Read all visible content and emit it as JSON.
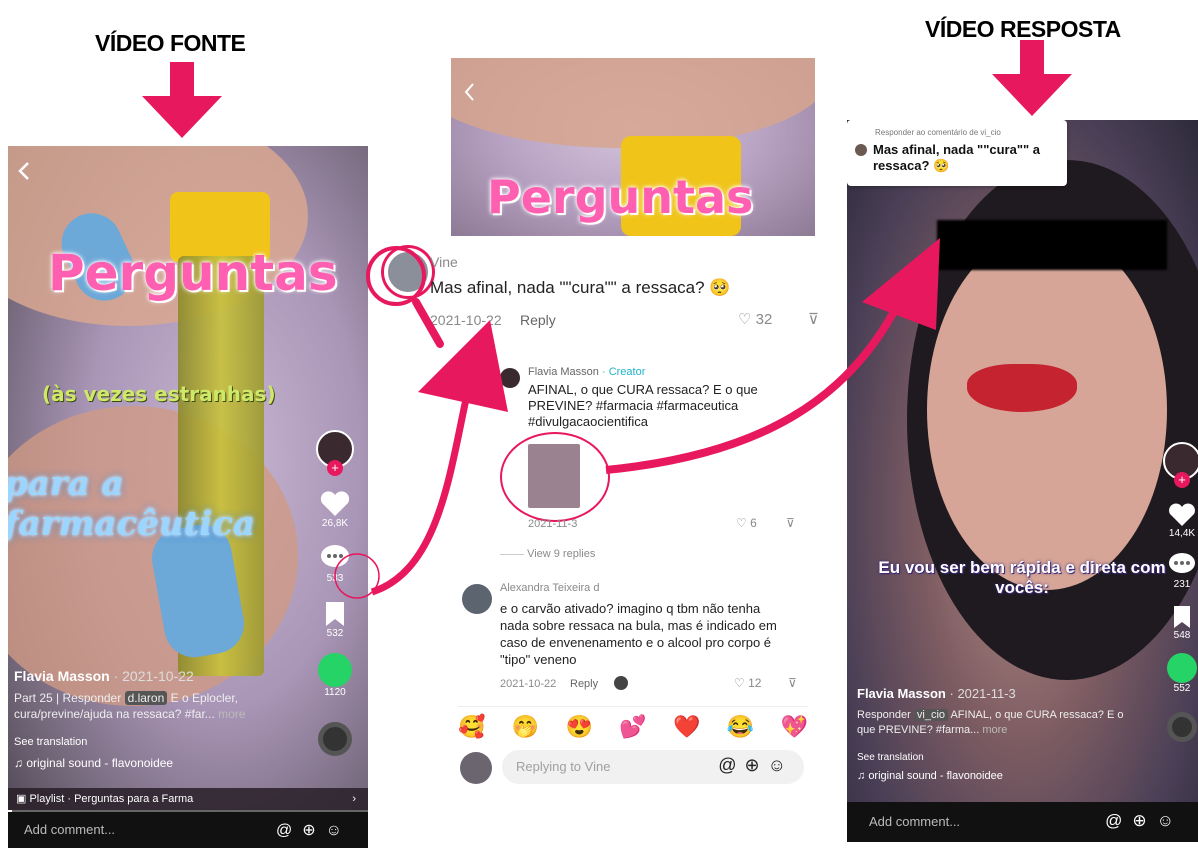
{
  "headings": {
    "source": "VÍDEO FONTE",
    "response": "VÍDEO RESPOSTA"
  },
  "colors": {
    "accent": "#e8185e",
    "overlay_pink": "#ff5fb0",
    "creator_teal": "#20b2c9"
  },
  "left": {
    "overlay_line1": "Perguntas",
    "overlay_line2": "(às vezes estranhas)",
    "overlay_line3": "para a farmacêutica",
    "likes": "26,8K",
    "comments": "533",
    "bookmarks": "532",
    "shares": "1120",
    "author": "Flavia Masson",
    "date": "· 2021-10-22",
    "part": "Part 25",
    "responder": "Responder",
    "mention": "d.laron",
    "caption": "E o Eplocler, cura/previne/ajuda na ressaca? #far...",
    "more": "more",
    "see_translation": "See translation",
    "sound": "original sound - flavonoidee",
    "playlist": "Playlist · Perguntas para a Farma",
    "add_comment": "Add comment..."
  },
  "middle": {
    "overlay": "Perguntas",
    "vine_user": "Vine",
    "vine_comment": "Mas afinal, nada \"\"cura\"\" a ressaca? 🥺",
    "vine_date": "2021-10-22",
    "reply": "Reply",
    "vine_likes": "32",
    "creator_name": "Flavia Masson",
    "creator_tag": "· Creator",
    "creator_text": "AFINAL, o que CURA ressaca? E o que PREVINE? #farmacia #farmaceutica #divulgacaocientifica",
    "creator_date": "2021-11-3",
    "creator_likes": "6",
    "view_replies": "View 9 replies",
    "alex_name": "Alexandra Teixeira d",
    "alex_text": "e o carvão ativado? imagino q tbm não tenha nada sobre ressaca na bula, mas é indicado em caso de envenenamento e o alcool pro corpo é \"tipo\" veneno",
    "alex_date": "2021-10-22",
    "alex_likes": "12",
    "emojis": [
      "🥰",
      "🤭",
      "😍",
      "💕",
      "❤️",
      "😂",
      "💖"
    ],
    "reply_placeholder": "Replying to Vine"
  },
  "right": {
    "reply_to": "Responder ao comentário de vi_cio",
    "quoted": "Mas afinal, nada \"\"cura\"\" a ressaca? 🥺",
    "caption_overlay": "Eu vou ser bem rápida e direta com vocês:",
    "likes": "14,4K",
    "comments": "231",
    "bookmarks": "548",
    "shares": "552",
    "author": "Flavia Masson",
    "date": "· 2021-11-3",
    "responder": "Responder",
    "mention": "vi_cio",
    "caption": "AFINAL, o que CURA ressaca? E o que PREVINE? #farma...",
    "more": "more",
    "see_translation": "See translation",
    "sound": "original sound - flavonoidee",
    "add_comment": "Add comment..."
  }
}
